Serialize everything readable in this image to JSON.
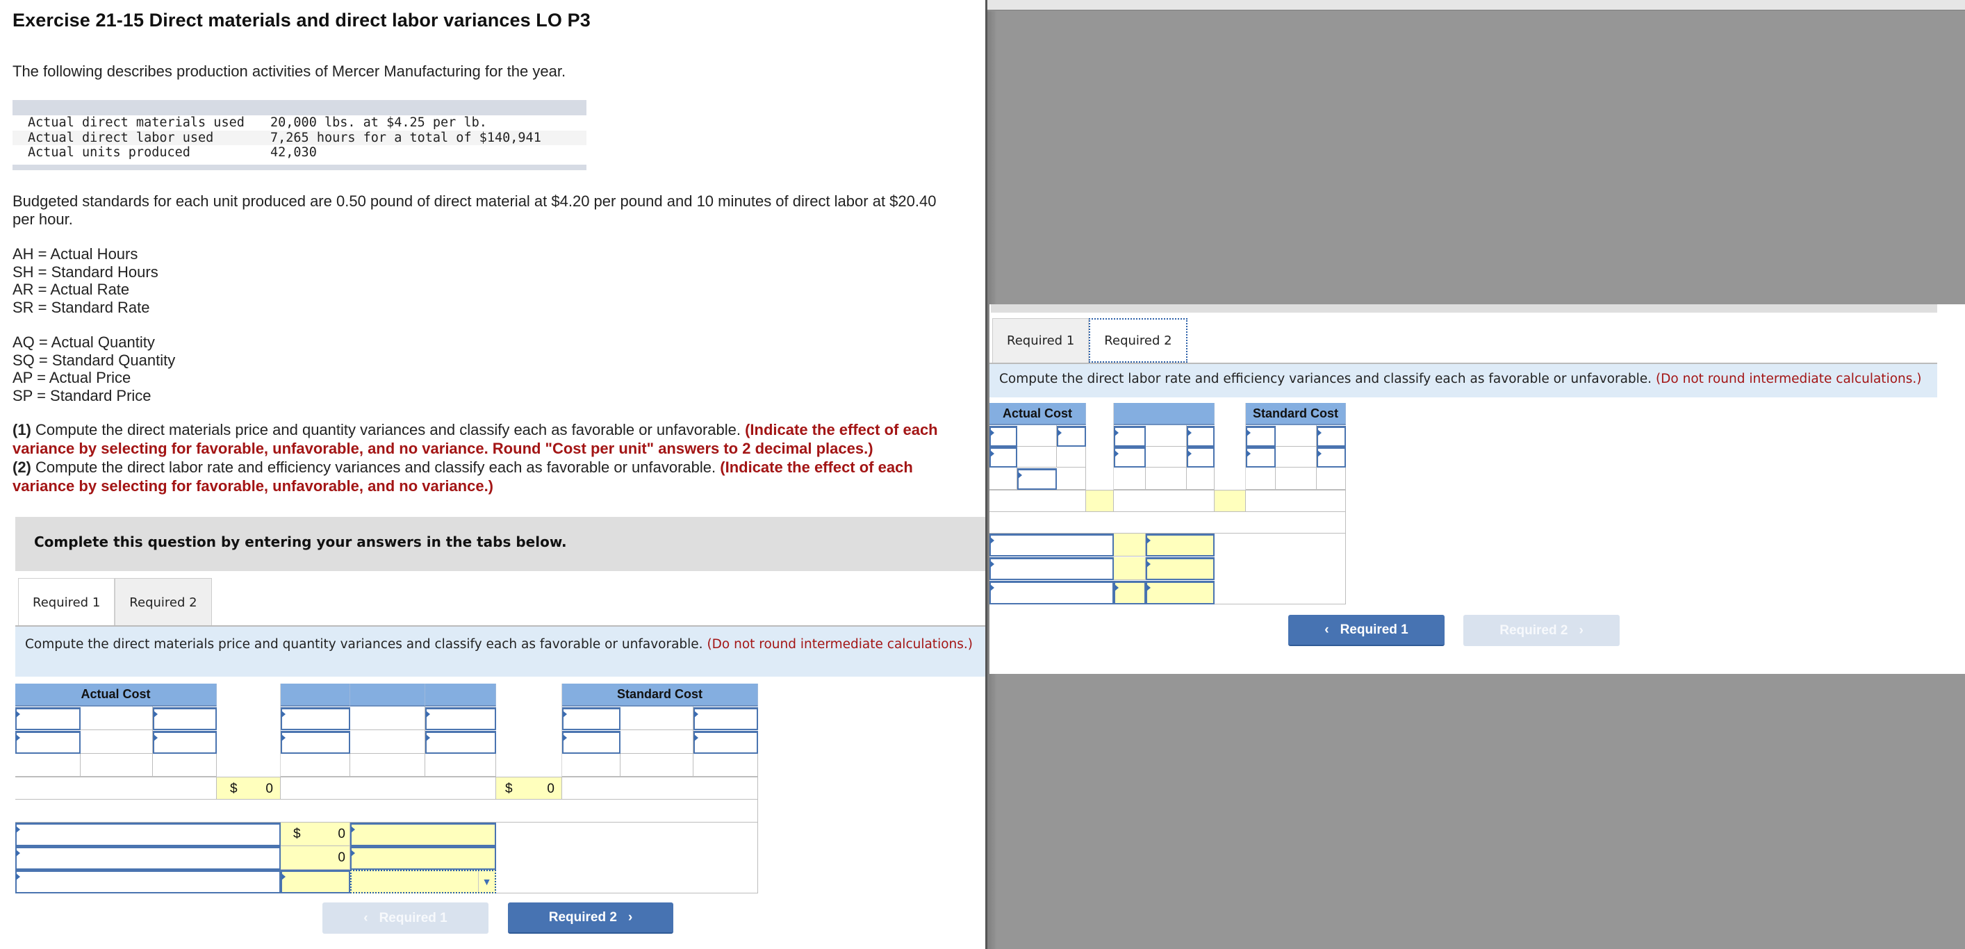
{
  "left": {
    "title": "Exercise 21-15 Direct materials and direct labor variances LO P3",
    "intro": "The following describes production activities of Mercer Manufacturing for the year.",
    "facts": [
      {
        "label": "Actual direct materials used",
        "value": "20,000 lbs. at $4.25 per lb."
      },
      {
        "label": "Actual direct labor used",
        "value": "7,265 hours for a total of $140,941"
      },
      {
        "label": "Actual units produced",
        "value": "42,030"
      }
    ],
    "budget_text": "Budgeted standards for each unit produced are 0.50 pound of direct material at $4.20 per pound and 10 minutes of direct labor at $20.40 per hour.",
    "definitions_labor": [
      "AH = Actual Hours",
      "SH = Standard Hours",
      "AR = Actual Rate",
      "SR = Standard Rate"
    ],
    "definitions_material": [
      "AQ = Actual Quantity",
      "SQ = Standard Quantity",
      "AP = Actual Price",
      "SP = Standard Price"
    ],
    "req1_num": "(1)",
    "req1_text": " Compute the direct materials price and quantity variances and classify each as favorable or unfavorable. ",
    "req1_note": "(Indicate the effect of each variance by selecting for favorable, unfavorable, and no variance. Round \"Cost per unit\" answers to 2 decimal places.)",
    "req2_num": "(2)",
    "req2_text": " Compute the direct labor rate and efficiency variances and classify each as favorable or unfavorable. ",
    "req2_note": "(Indicate the effect of each variance by selecting for favorable, unfavorable, and no variance.)",
    "complete_banner": "Complete this question by entering your answers in the tabs below.",
    "tabs": [
      "Required 1",
      "Required 2"
    ],
    "active_tab": "Required 1",
    "instruction": "Compute the direct materials price and quantity variances and classify each as favorable or unfavorable. ",
    "instruction_note": "(Do not round intermediate calculations.)",
    "table": {
      "header_actual": "Actual Cost",
      "header_standard": "Standard Cost",
      "total_actual_currency": "$",
      "total_actual_value": "0",
      "total_standard_currency": "$",
      "total_standard_value": "0",
      "variance_rows": [
        {
          "currency": "$",
          "value": "0"
        },
        {
          "currency": "",
          "value": "0"
        },
        {
          "currency": "",
          "value": ""
        }
      ]
    },
    "nav": {
      "prev": "Required 1",
      "next": "Required 2",
      "prev_enabled": false,
      "next_enabled": true
    }
  },
  "right": {
    "tabs": [
      "Required 1",
      "Required 2"
    ],
    "active_tab": "Required 2",
    "instruction": "Compute the direct labor rate and efficiency variances and classify each as favorable or unfavorable. ",
    "instruction_note": "(Do not round intermediate calculations.)",
    "table": {
      "header_actual": "Actual Cost",
      "header_standard": "Standard Cost"
    },
    "nav": {
      "prev": "Required 1",
      "next": "Required 2",
      "prev_enabled": true,
      "next_enabled": false
    }
  },
  "icons": {
    "chevron_left": "‹",
    "chevron_right": "›",
    "dropdown": "▼"
  }
}
